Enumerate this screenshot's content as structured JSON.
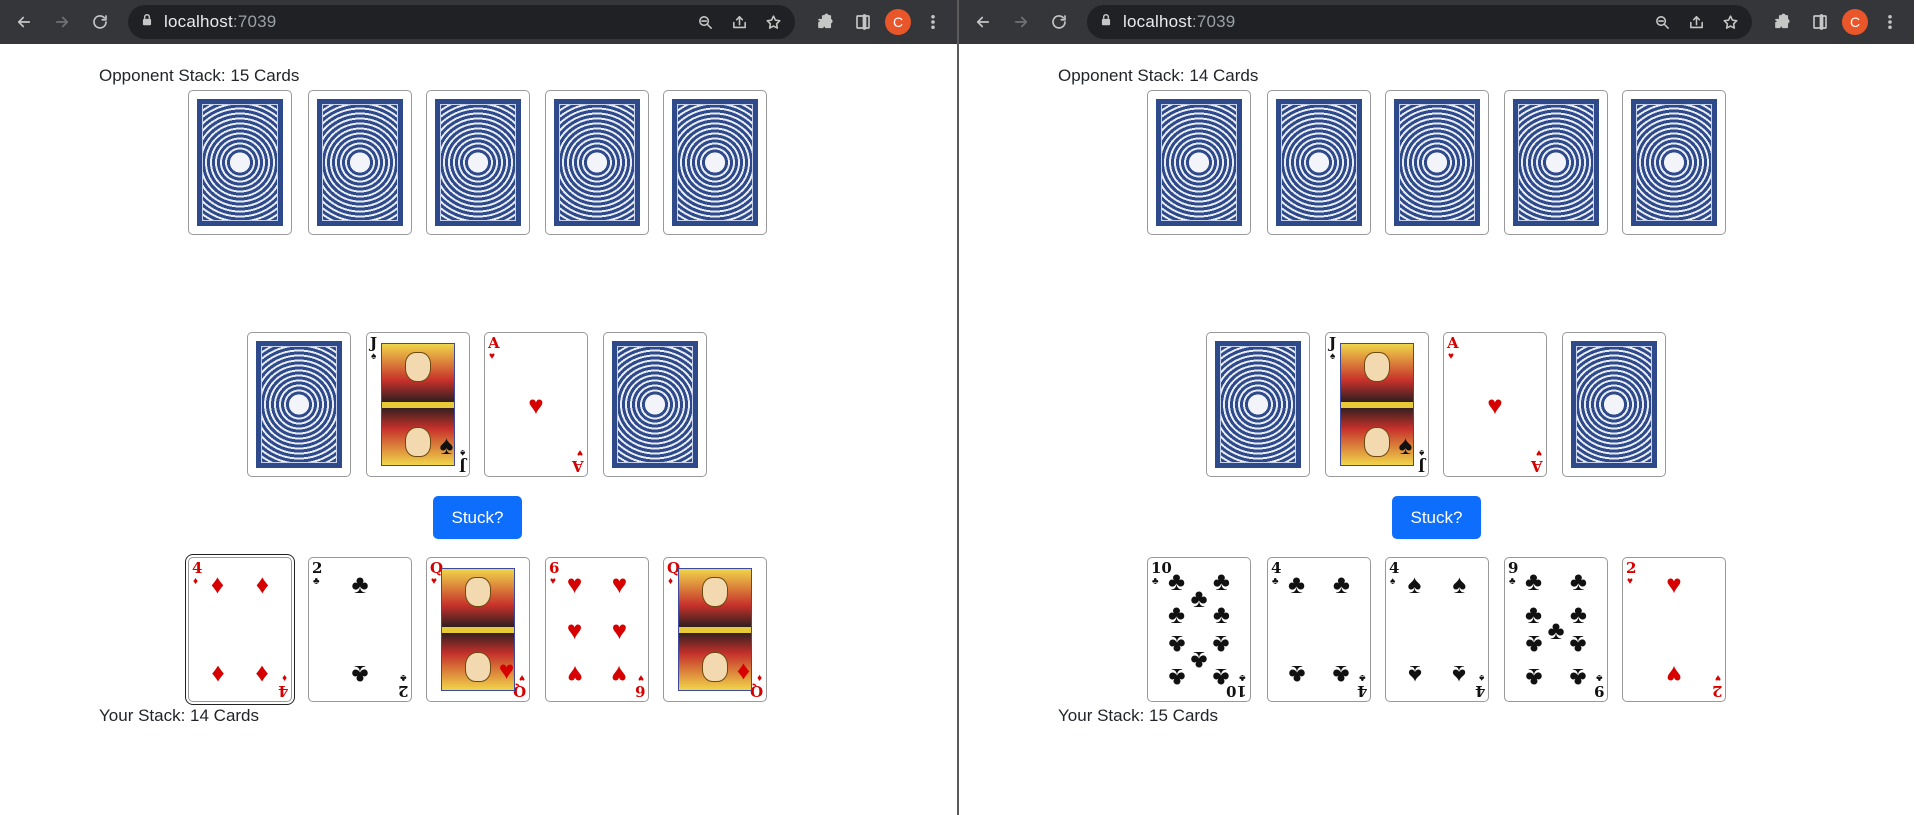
{
  "browser": {
    "url_host": "localhost",
    "url_port": ":7039",
    "profile_initial": "C"
  },
  "windows": [
    {
      "opponent_label": "Opponent Stack: 15 Cards",
      "your_label": "Your Stack: 14 Cards",
      "stuck_button": "Stuck?",
      "opponent_hand": [
        "back",
        "back",
        "back",
        "back",
        "back"
      ],
      "table": [
        {
          "type": "back"
        },
        {
          "type": "face",
          "rank": "J",
          "suit": "♠",
          "color": "black"
        },
        {
          "type": "pip",
          "rank": "A",
          "suit": "♥",
          "color": "red"
        },
        {
          "type": "back"
        }
      ],
      "hand": [
        {
          "rank": "4",
          "suit": "♦",
          "color": "red",
          "selected": true
        },
        {
          "rank": "2",
          "suit": "♣",
          "color": "black"
        },
        {
          "rank": "Q",
          "suit": "♥",
          "color": "red",
          "face": true
        },
        {
          "rank": "6",
          "suit": "♥",
          "color": "red"
        },
        {
          "rank": "Q",
          "suit": "♦",
          "color": "red",
          "face": true
        }
      ]
    },
    {
      "opponent_label": "Opponent Stack: 14 Cards",
      "your_label": "Your Stack: 15 Cards",
      "stuck_button": "Stuck?",
      "opponent_hand": [
        "back",
        "back",
        "back",
        "back",
        "back"
      ],
      "table": [
        {
          "type": "back"
        },
        {
          "type": "face",
          "rank": "J",
          "suit": "♠",
          "color": "black"
        },
        {
          "type": "pip",
          "rank": "A",
          "suit": "♥",
          "color": "red"
        },
        {
          "type": "back"
        }
      ],
      "hand": [
        {
          "rank": "10",
          "suit": "♣",
          "color": "black"
        },
        {
          "rank": "4",
          "suit": "♣",
          "color": "black"
        },
        {
          "rank": "4",
          "suit": "♠",
          "color": "black"
        },
        {
          "rank": "9",
          "suit": "♣",
          "color": "black"
        },
        {
          "rank": "2",
          "suit": "♥",
          "color": "red"
        }
      ]
    }
  ]
}
